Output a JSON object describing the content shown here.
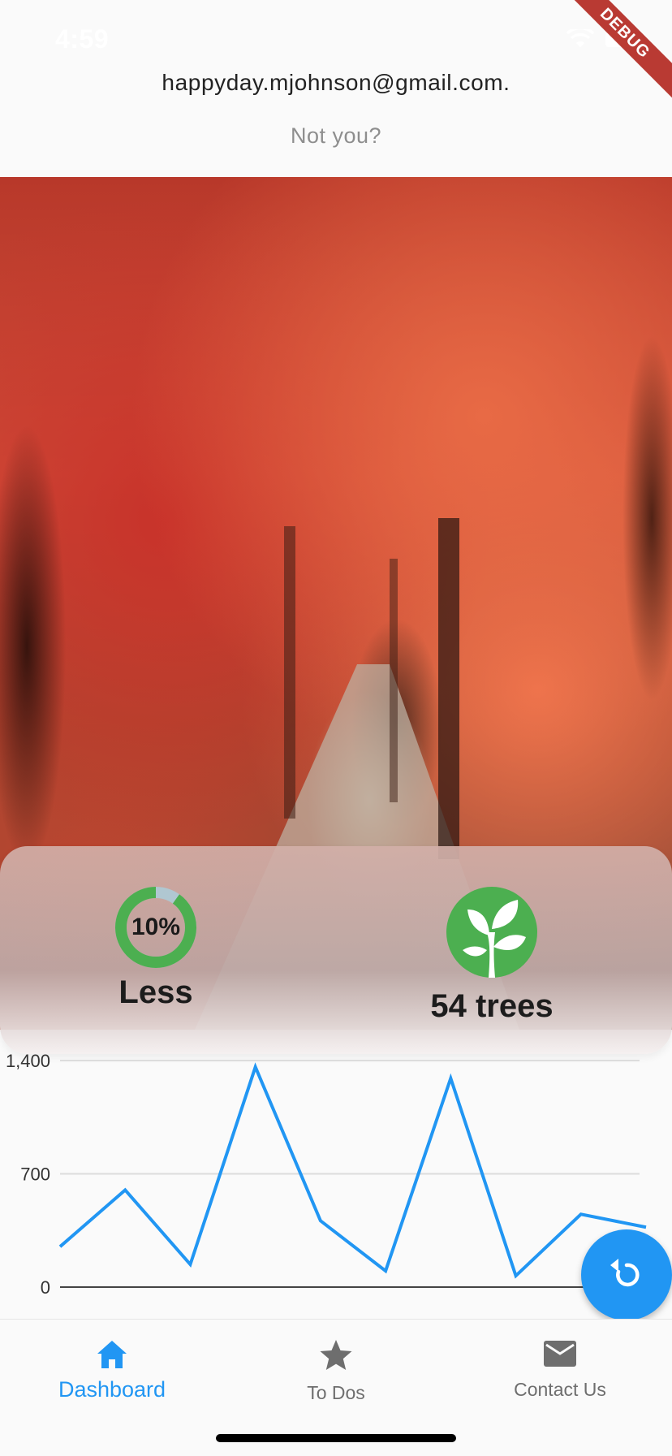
{
  "status_bar": {
    "time": "4:59"
  },
  "debug_banner": "DEBUG",
  "account": {
    "email": "happyday.mjohnson@gmail.com.",
    "not_you": "Not you?"
  },
  "stats": {
    "percent_label": "10%",
    "percent_value": 0.9,
    "percent_caption": "Less",
    "trees_caption": "54 trees"
  },
  "chart_data": {
    "type": "line",
    "y_ticks": [
      "1,400",
      "700",
      "0"
    ],
    "ylim": [
      0,
      1400
    ],
    "series": [
      {
        "values": [
          250,
          600,
          140,
          1360,
          410,
          100,
          1290,
          70,
          450,
          370
        ]
      }
    ],
    "color": "#2196f3",
    "grid": true
  },
  "fab": {
    "icon": "refresh-icon"
  },
  "bottom_nav": {
    "items": [
      {
        "label": "Dashboard",
        "icon": "home-icon",
        "active": true
      },
      {
        "label": "To Dos",
        "icon": "star-icon",
        "active": false
      },
      {
        "label": "Contact Us",
        "icon": "mail-icon",
        "active": false
      }
    ]
  },
  "colors": {
    "accent": "#2196f3",
    "ring_progress": "#4caf50",
    "ring_track": "#b0c7d1",
    "tree_bg": "#4caf50"
  }
}
